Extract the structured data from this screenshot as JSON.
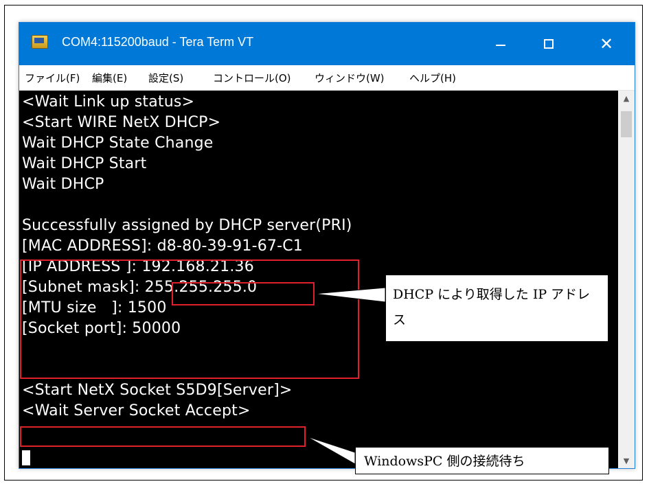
{
  "window": {
    "title": "COM4:115200baud - Tera Term VT",
    "min_glyph": "",
    "close_glyph": "✕"
  },
  "menu": {
    "items": [
      {
        "label": "ファイル(F)"
      },
      {
        "label": "編集(E)"
      },
      {
        "label": "設定(S)"
      },
      {
        "label": "コントロール(O)"
      },
      {
        "label": "ウィンドウ(W)"
      },
      {
        "label": "ヘルプ(H)"
      }
    ]
  },
  "terminal": {
    "lines": [
      "<Wait Link up status>",
      "<Start WIRE NetX DHCP>",
      "Wait DHCP State Change",
      "Wait DHCP Start",
      "Wait DHCP",
      "",
      "Successfully assigned by DHCP server(PRI)",
      "[MAC ADDRESS]: d8-80-39-91-67-C1",
      "[IP ADDRESS ]: 192.168.21.36",
      "[Subnet mask]: 255.255.255.0",
      "[MTU size   ]: 1500",
      "[Socket port]: 50000",
      "",
      "<Start NetX Socket S5D9[Server]>",
      "<Wait Server Socket Accept>"
    ]
  },
  "annotations": {
    "ip_callout": "DHCP により取得した IP アドレス",
    "accept_callout": "WindowsPC 側の接続待ち",
    "highlight_color": "#e0202a"
  },
  "colors": {
    "titlebar": "#0078d7",
    "terminal_bg": "#000000",
    "terminal_fg": "#ffffff"
  }
}
